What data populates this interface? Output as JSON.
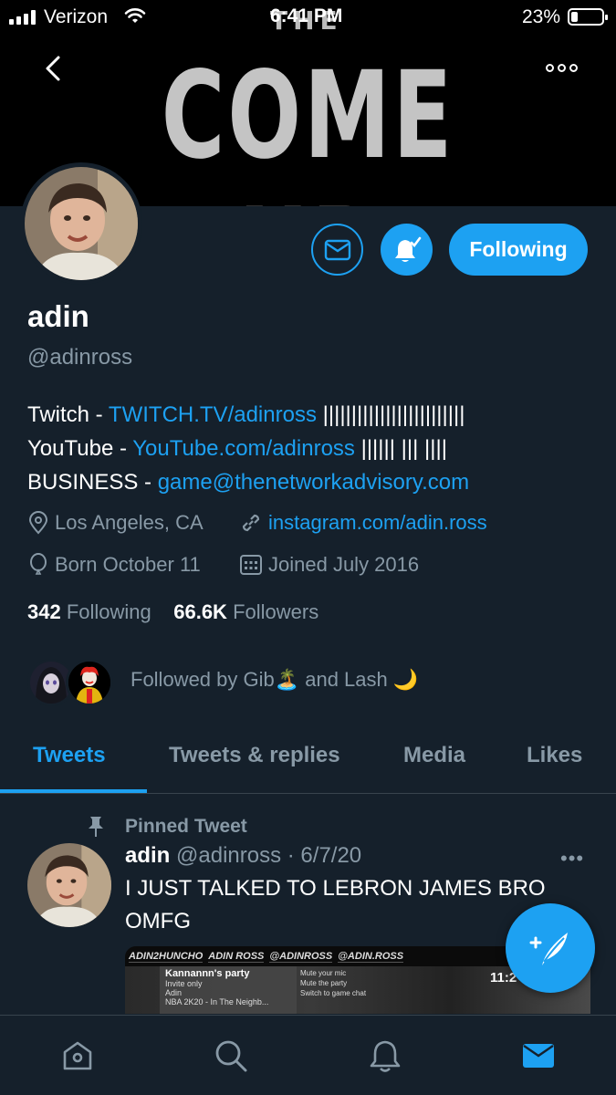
{
  "status_bar": {
    "carrier": "Verizon",
    "time": "6:41 PM",
    "battery_percent": "23%",
    "battery_level": 0.23
  },
  "banner": {
    "small_text": "THE",
    "big_text": "COME UP"
  },
  "profile": {
    "name": "adin",
    "handle": "@adinross",
    "follow_button_label": "Following",
    "bio": [
      {
        "prefix": "Twitch - ",
        "link": "TWITCH.TV/adinross",
        "suffix": " |||||||||||||||||||||||||"
      },
      {
        "prefix": "YouTube - ",
        "link": "YouTube.com/adinross",
        "suffix": " |||||| ||| ||||"
      },
      {
        "prefix": "BUSINESS - ",
        "link": "game@thenetworkadvisory.com",
        "suffix": ""
      }
    ],
    "location": "Los Angeles, CA",
    "website": "instagram.com/adin.ross",
    "birthday": "Born October 11",
    "joined": "Joined July 2016",
    "following_count": "342",
    "following_label": "Following",
    "followers_count": "66.6K",
    "followers_label": "Followers",
    "followed_by": "Followed by Gib🏝️ and Lash 🌙"
  },
  "tabs": [
    {
      "label": "Tweets",
      "active": true
    },
    {
      "label": "Tweets & replies",
      "active": false
    },
    {
      "label": "Media",
      "active": false
    },
    {
      "label": "Likes",
      "active": false
    }
  ],
  "pinned_tweet": {
    "label": "Pinned Tweet",
    "name": "adin",
    "handle": "@adinross",
    "date": "· 6/7/20",
    "more": "•••",
    "text": "I JUST TALKED TO LEBRON JAMES BRO OMFG",
    "media": {
      "tags": [
        "ADIN2HUNCHO",
        "ADIN ROSS",
        "@ADINROSS",
        "@ADIN.ROSS"
      ],
      "party_title": "Kannannn's party",
      "party_sub": "Invite only",
      "party_member": "Adin",
      "party_member_sub": "NBA 2K20 - In The Neighb...",
      "options": [
        "Mute your mic",
        "Mute the party",
        "Switch to game chat"
      ],
      "clock": "11:2"
    }
  },
  "icons": {
    "back": "chevron-left-icon",
    "more": "more-dots-icon",
    "message": "envelope-icon",
    "notifications": "bell-check-icon",
    "location": "location-pin-icon",
    "link": "link-icon",
    "birthday": "balloon-icon",
    "calendar": "calendar-icon",
    "pin": "pin-icon",
    "compose": "compose-feather-icon"
  },
  "bottom_nav": [
    "home",
    "search",
    "notifications",
    "messages"
  ],
  "colors": {
    "background": "#15202b",
    "accent": "#1da1f2",
    "secondary_text": "#8899a6",
    "border": "#38444d"
  }
}
